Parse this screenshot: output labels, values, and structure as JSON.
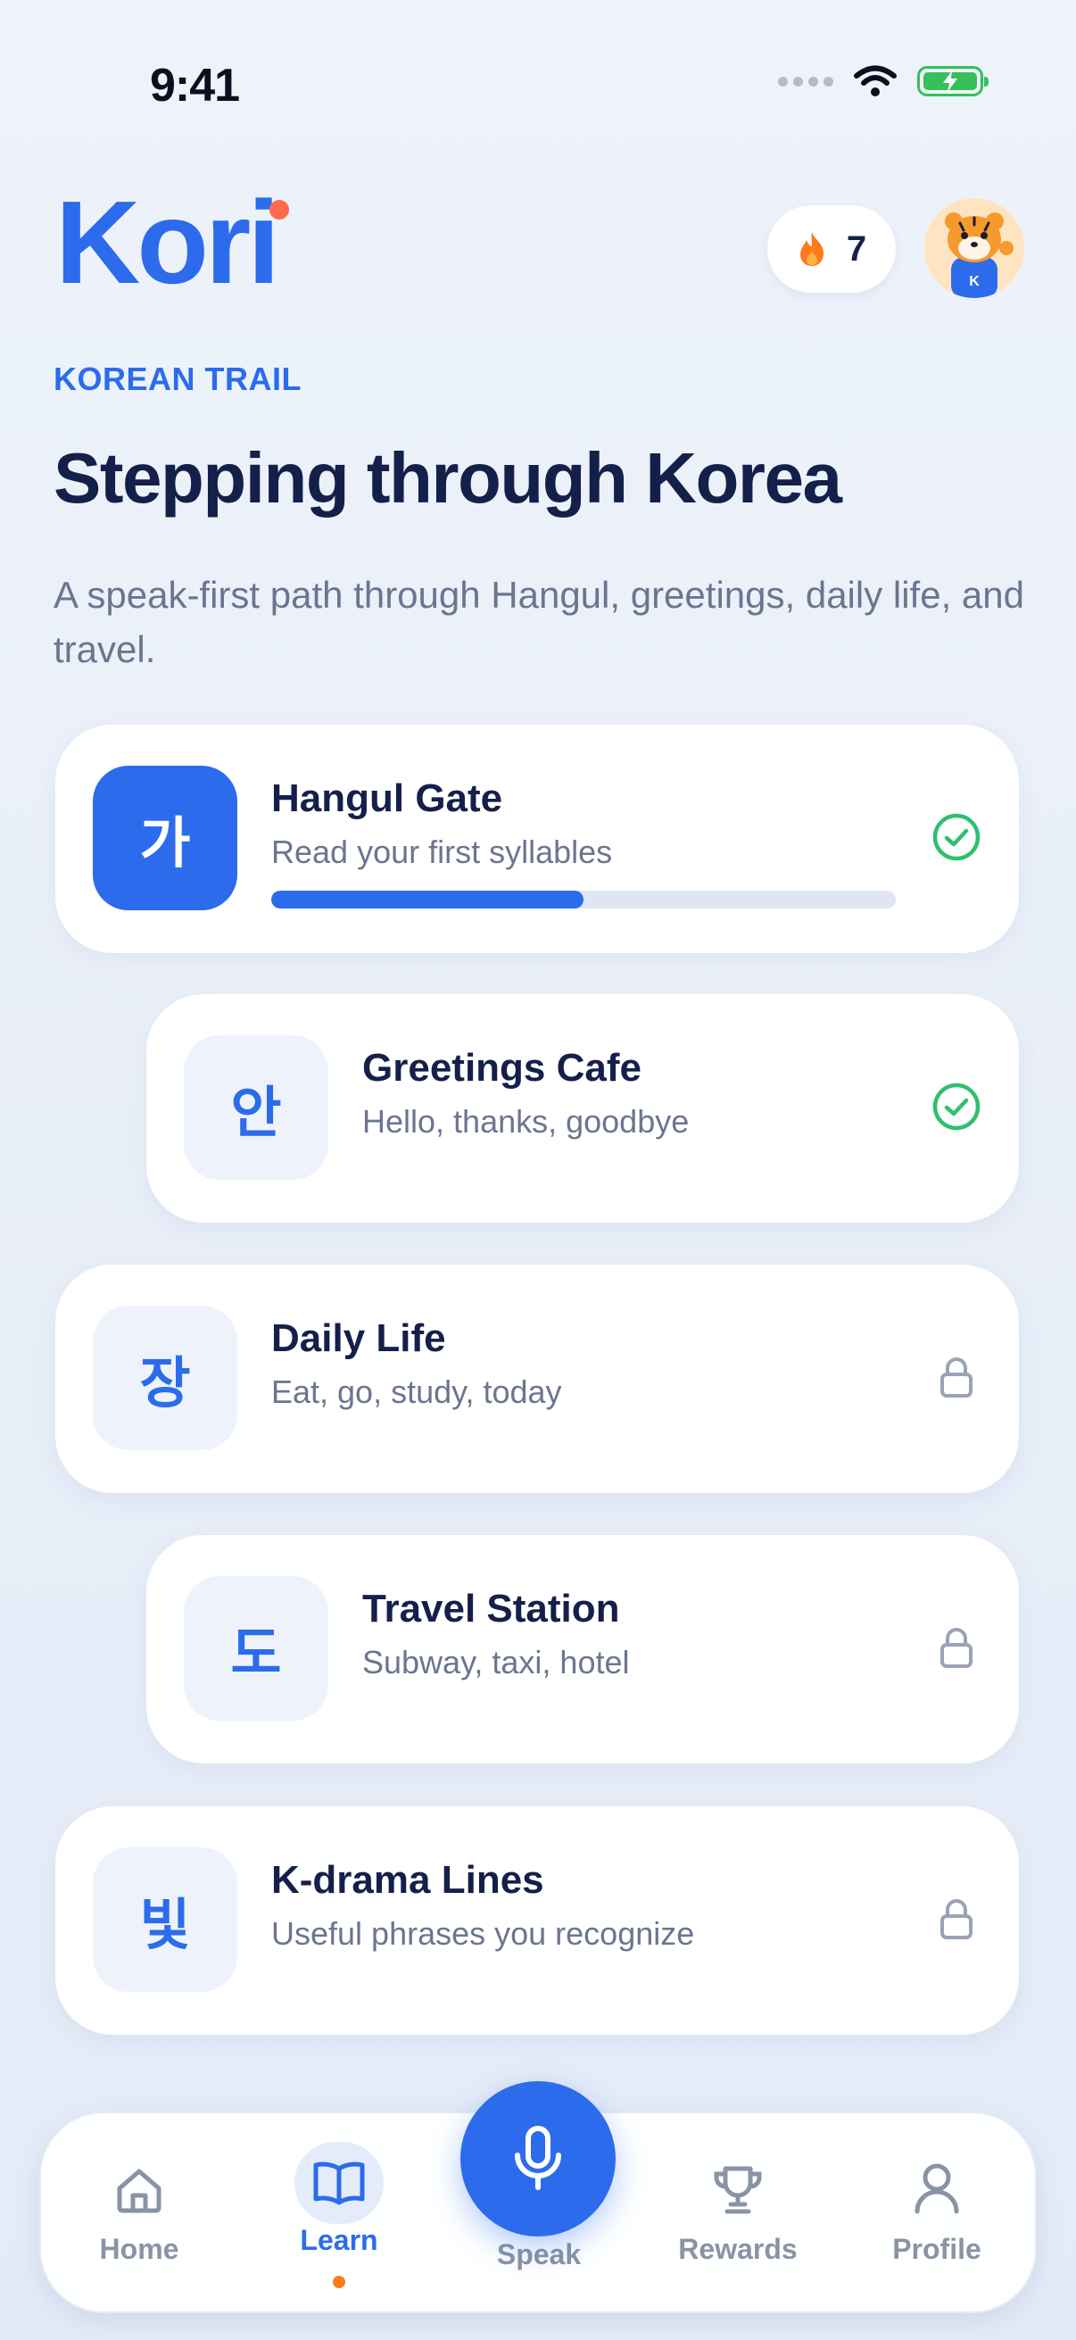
{
  "status_bar": {
    "time": "9:41"
  },
  "header": {
    "logo_text": "Kori",
    "streak_count": "7",
    "streak_icon": "flame-icon",
    "avatar_icon": "tiger-mascot-avatar"
  },
  "intro": {
    "eyebrow": "KOREAN TRAIL",
    "title": "Stepping through Korea",
    "subtitle": "A speak-first path through Hangul, greetings, daily life, and travel."
  },
  "lessons": [
    {
      "glyph": "가",
      "title": "Hangul Gate",
      "subtitle": "Read your first syllables",
      "status": "completed",
      "progress": 0.5
    },
    {
      "glyph": "안",
      "title": "Greetings Cafe",
      "subtitle": "Hello, thanks, goodbye",
      "status": "completed"
    },
    {
      "glyph": "장",
      "title": "Daily Life",
      "subtitle": "Eat, go, study, today",
      "status": "locked"
    },
    {
      "glyph": "도",
      "title": "Travel Station",
      "subtitle": "Subway, taxi, hotel",
      "status": "locked"
    },
    {
      "glyph": "빛",
      "title": "K-drama Lines",
      "subtitle": "Useful phrases you recognize",
      "status": "locked"
    }
  ],
  "nav": {
    "home": "Home",
    "learn": "Learn",
    "speak": "Speak",
    "rewards": "Rewards",
    "profile": "Profile",
    "active": "learn"
  },
  "colors": {
    "accent": "#2c6cec",
    "success": "#2fbf71",
    "streak": "#ff7a1a",
    "logo_dot": "#ff6a4a"
  }
}
